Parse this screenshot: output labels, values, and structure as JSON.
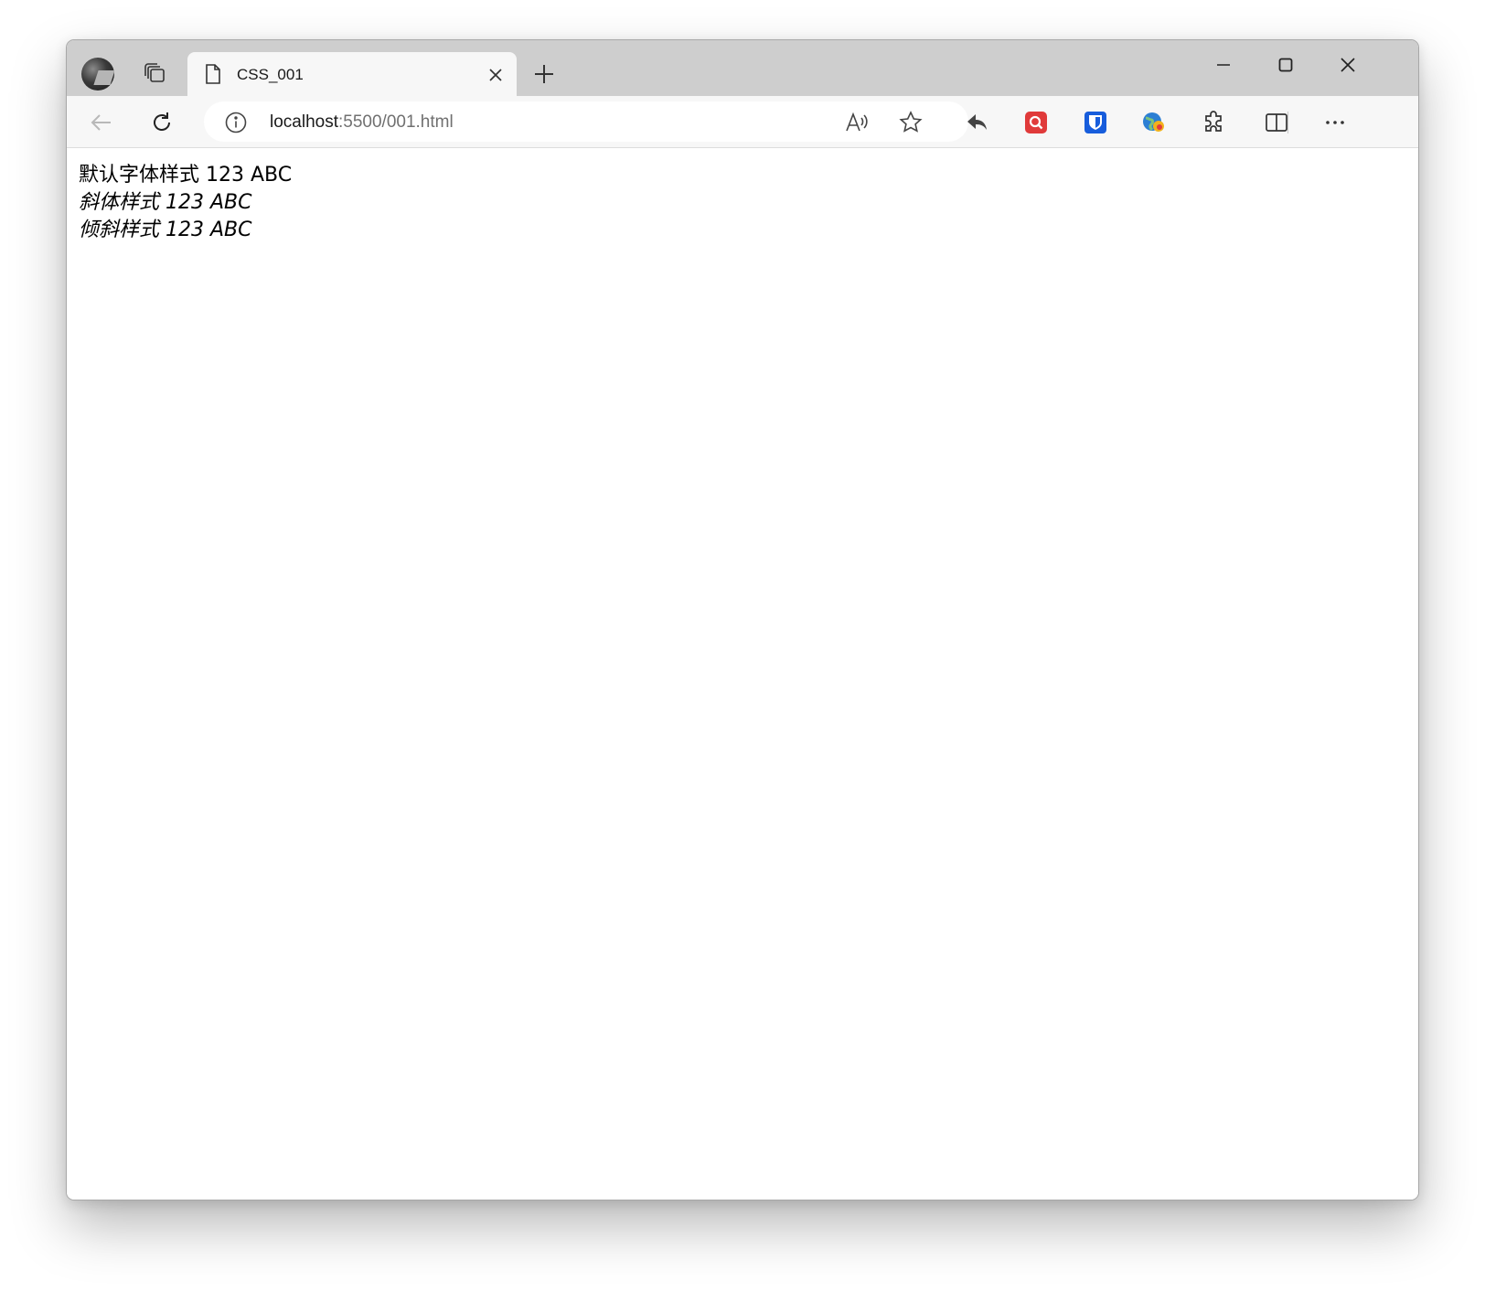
{
  "browser": {
    "tab": {
      "title": "CSS_001"
    },
    "address": {
      "host": "localhost",
      "rest": ":5500/001.html"
    },
    "toolbar_icons": [
      "back-icon",
      "refresh-icon",
      "site-info-icon",
      "read-aloud-icon",
      "favorite-star-icon",
      "reply-icon",
      "search-extension-icon",
      "bitwarden-icon",
      "translate-extension-icon",
      "extensions-puzzle-icon",
      "split-screen-icon",
      "more-menu-icon"
    ],
    "window_controls": [
      "minimize-icon",
      "maximize-icon",
      "close-window-icon"
    ],
    "colors": {
      "titlebar": "#cecece",
      "toolbar": "#f7f7f7",
      "red_ext": "#e03a3a",
      "blue_ext": "#175ddc"
    }
  },
  "page": {
    "lines": [
      "默认字体样式 123 ABC",
      "斜体样式 123 ABC",
      "倾斜样式 123 ABC"
    ]
  }
}
